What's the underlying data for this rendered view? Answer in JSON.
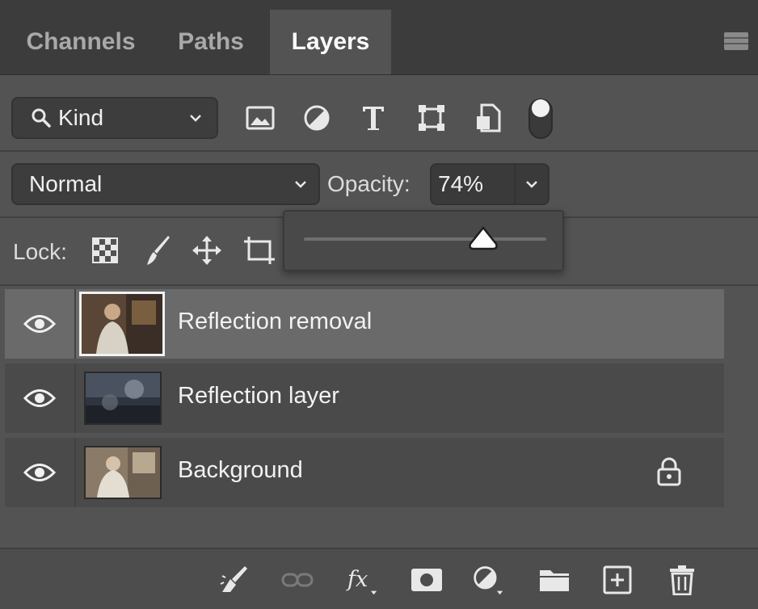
{
  "tabs": [
    {
      "label": "Channels",
      "active": false
    },
    {
      "label": "Paths",
      "active": false
    },
    {
      "label": "Layers",
      "active": true
    }
  ],
  "panel_menu_icon": "panel-menu-icon",
  "filter": {
    "kind_label": "Kind",
    "icons": [
      "image-filter-icon",
      "adjustment-filter-icon",
      "type-filter-icon",
      "shape-filter-icon",
      "smart-object-filter-icon",
      "filter-toggle-icon"
    ]
  },
  "blend": {
    "mode": "Normal",
    "opacity_label": "Opacity:",
    "opacity_value": "74%",
    "opacity_fraction": 0.74
  },
  "lock": {
    "label": "Lock:",
    "icons": [
      "lock-transparent-pixels-icon",
      "lock-image-pixels-icon",
      "lock-position-icon",
      "lock-artboard-icon"
    ]
  },
  "layers": [
    {
      "name": "Reflection removal",
      "visible": true,
      "selected": true,
      "locked": false
    },
    {
      "name": "Reflection layer",
      "visible": true,
      "selected": false,
      "locked": false
    },
    {
      "name": "Background",
      "visible": true,
      "selected": false,
      "locked": true
    }
  ],
  "bottom_icons": [
    "cleanup-brush-icon",
    "link-layers-icon",
    "layer-style-fx-icon",
    "add-mask-icon",
    "new-adjustment-layer-icon",
    "new-group-folder-icon",
    "new-layer-icon",
    "delete-layer-icon"
  ],
  "colors": {
    "panel_bg": "#535353",
    "tab_bar_bg": "#3c3c3c",
    "selected_row": "#6a6a6a",
    "row_bg": "#4a4a4a"
  }
}
